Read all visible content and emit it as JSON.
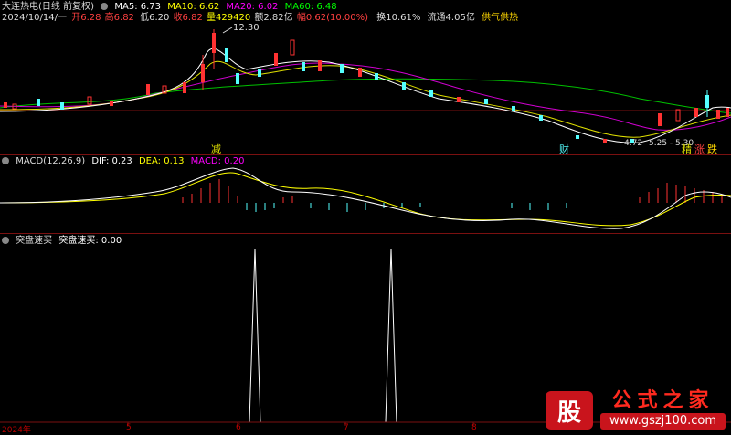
{
  "header": {
    "stock_name": "大连热电(日线 前复权)",
    "ma5": "MA5: 6.73",
    "ma10": "MA10: 6.62",
    "ma20": "MA20: 6.02",
    "ma60": "MA60: 6.48",
    "date": "2024/10/14/一",
    "open": "开6.28",
    "high": "高6.82",
    "low": "低6.20",
    "close": "收6.82",
    "volume": "量429420",
    "amount": "额2.82亿",
    "change": "幅0.62(10.00%)",
    "turnover": "换10.61%",
    "float_cap": "流通4.05亿",
    "concept": "供气供热"
  },
  "annotations": {
    "peak": "12.30",
    "low_label": "4.72",
    "range_label": "5.25 - 5.30",
    "tag1": "减",
    "tag2": "财",
    "tag3": "精",
    "tag4": "涨",
    "tag5": "跌"
  },
  "macd": {
    "title": "MACD(12,26,9)",
    "dif": "DIF: 0.23",
    "dea": "DEA: 0.13",
    "macd": "MACD: 0.20"
  },
  "indicator": {
    "title": "突盘速买",
    "value": "突盘速买: 0.00"
  },
  "xaxis": [
    "2024年",
    "5",
    "6",
    "7",
    "8"
  ],
  "watermark": {
    "logo_char": "股",
    "title": "公式之家",
    "url": "www.gszj100.com"
  },
  "colors": {
    "ma5": "#ffffff",
    "ma10": "#ffff00",
    "ma20": "#ff00ff",
    "ma60": "#00ff00",
    "up": "#ff3232",
    "down": "#54ffff"
  }
}
